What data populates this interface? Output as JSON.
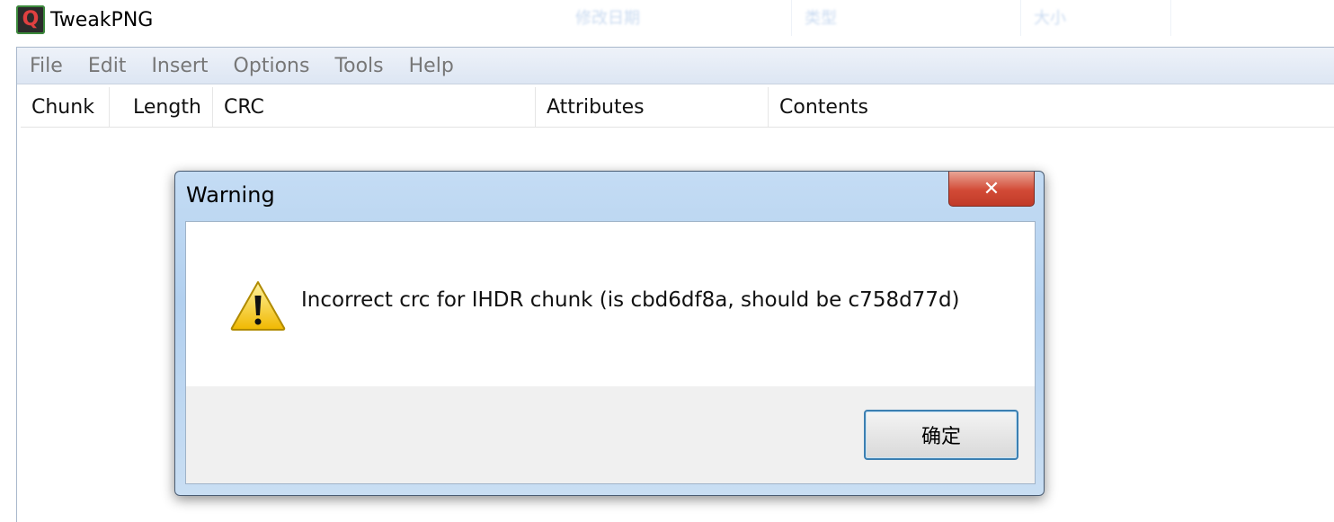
{
  "app": {
    "title": "TweakPNG"
  },
  "menu": [
    "File",
    "Edit",
    "Insert",
    "Options",
    "Tools",
    "Help"
  ],
  "table": {
    "columns": [
      "Chunk",
      "Length",
      "CRC",
      "Attributes",
      "Contents"
    ]
  },
  "dialog": {
    "title": "Warning",
    "close_glyph": "✕",
    "message": "Incorrect crc for IHDR chunk (is cbd6df8a, should be c758d77d)",
    "ok_label": "确定",
    "icon": "warning-icon"
  },
  "background_explorer": {
    "columns": [
      "修改日期",
      "类型",
      "大小"
    ]
  },
  "colors": {
    "dialog_frame": "#b2d0ef",
    "close_button": "#d24a36",
    "ok_border": "#3c7fb1",
    "warning_yellow": "#f5c400"
  }
}
